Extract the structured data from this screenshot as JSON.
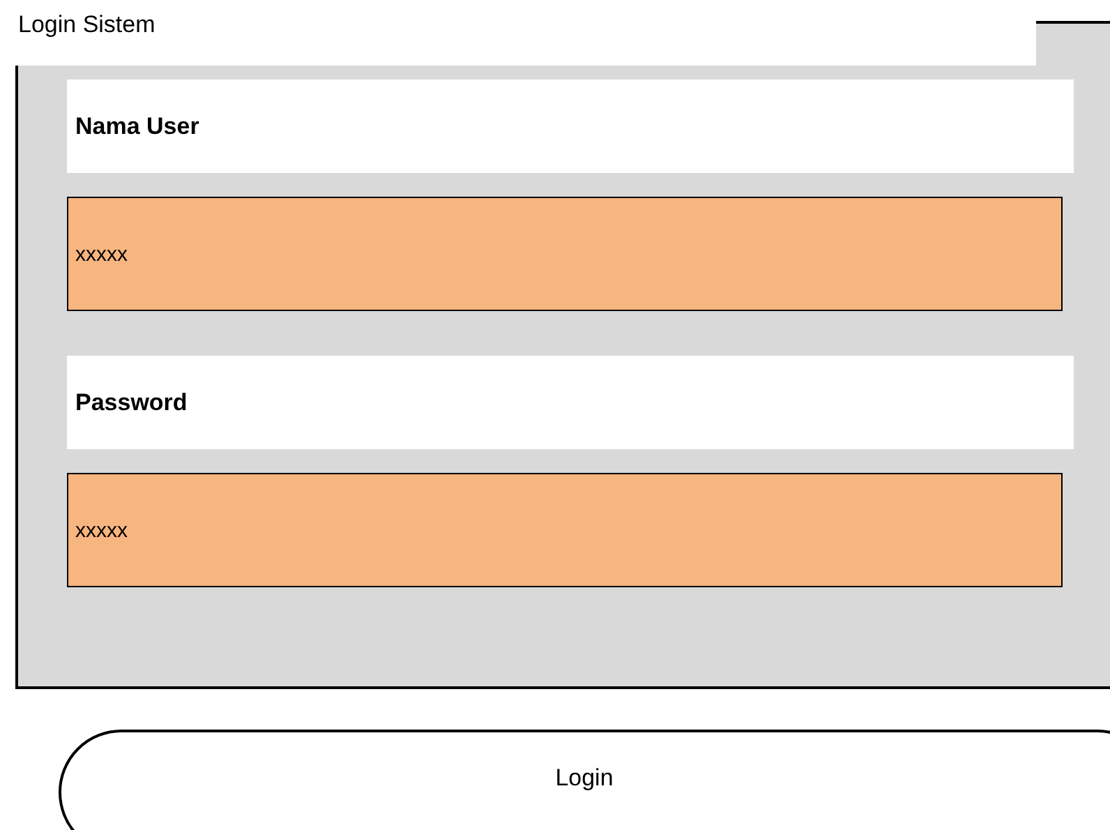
{
  "title": "Login Sistem",
  "fields": [
    {
      "label": "Nama User",
      "value": "xxxxx"
    },
    {
      "label": "Password",
      "value": "xxxxx"
    }
  ],
  "button": "Login"
}
